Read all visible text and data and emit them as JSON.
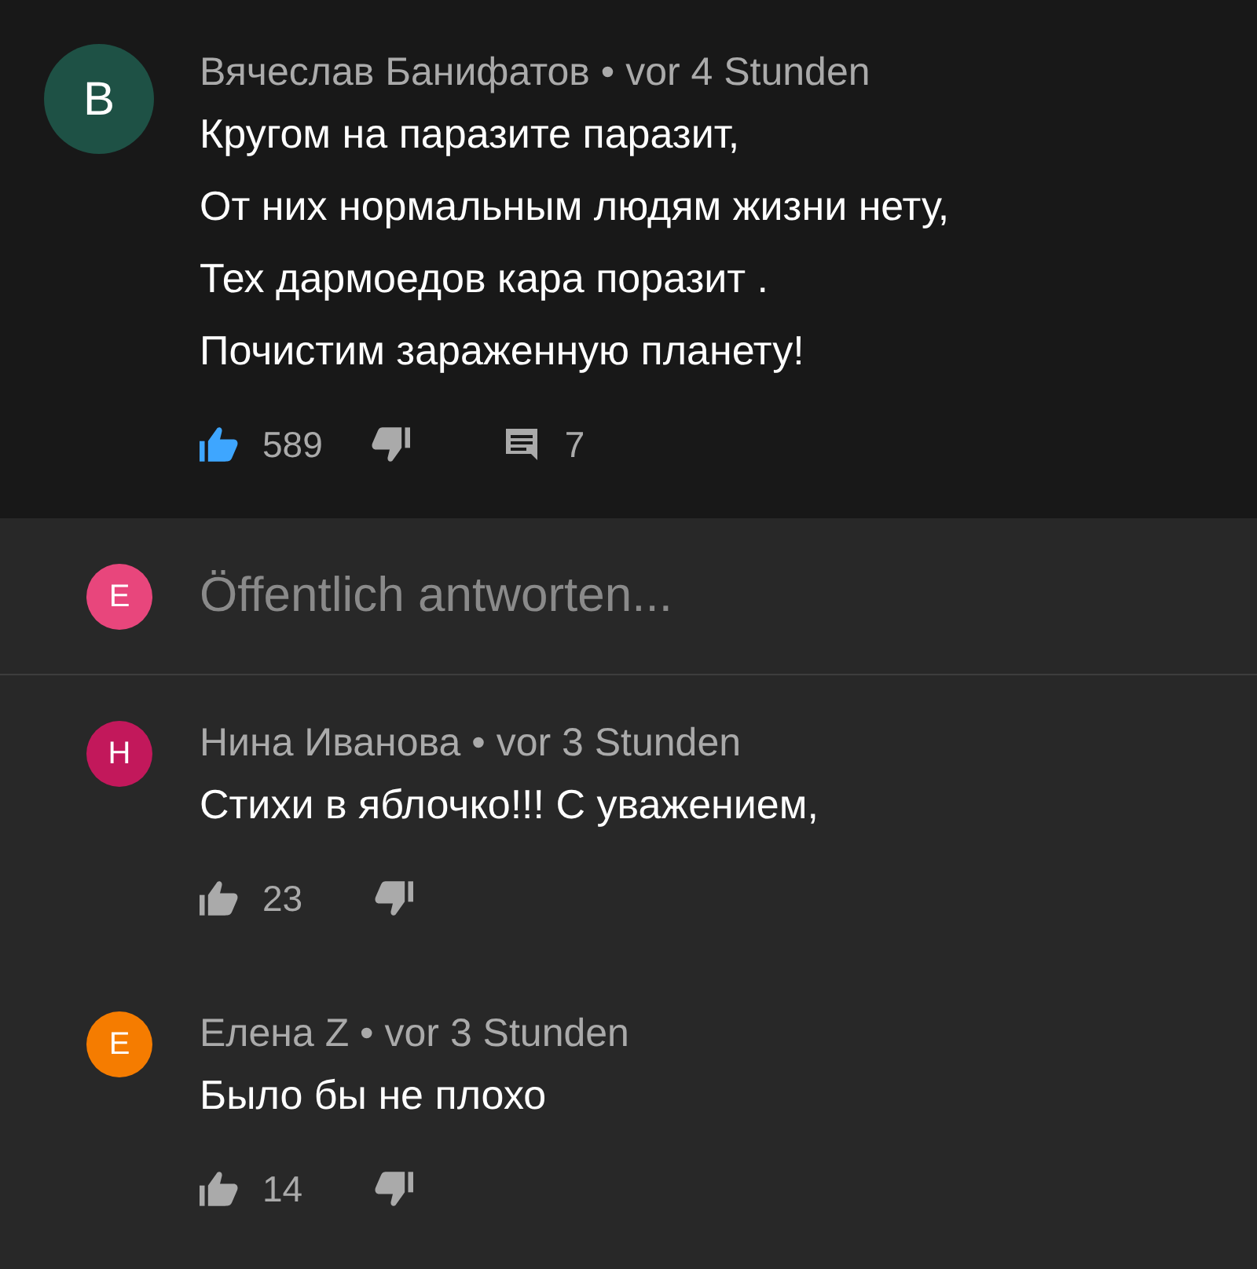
{
  "comment": {
    "avatar_letter": "В",
    "color": "#1e5145",
    "author": "Вячеслав Банифатов",
    "separator": "•",
    "time": "vor 4 Stunden",
    "lines": [
      "Кругом на паразите паразит,",
      "От них нормальным людям жизни нету,",
      "Тех дармоедов кара поразит .",
      "Почистим зараженную планету!"
    ],
    "likes": "589",
    "liked": true,
    "reply_count": "7"
  },
  "reply_box": {
    "avatar_letter": "E",
    "color": "#e8467c",
    "placeholder": "Öffentlich antworten..."
  },
  "replies": [
    {
      "avatar_letter": "H",
      "color": "#c2185b",
      "author": "Нина Иванова",
      "separator": "•",
      "time": "vor 3 Stunden",
      "text": "Стихи в яблочко!!! С уважением,",
      "likes": "23",
      "liked": false
    },
    {
      "avatar_letter": "E",
      "color": "#f57c00",
      "author": "Елена Z",
      "separator": "•",
      "time": "vor 3 Stunden",
      "text": "Было бы не плохо",
      "likes": "14",
      "liked": false
    }
  ]
}
